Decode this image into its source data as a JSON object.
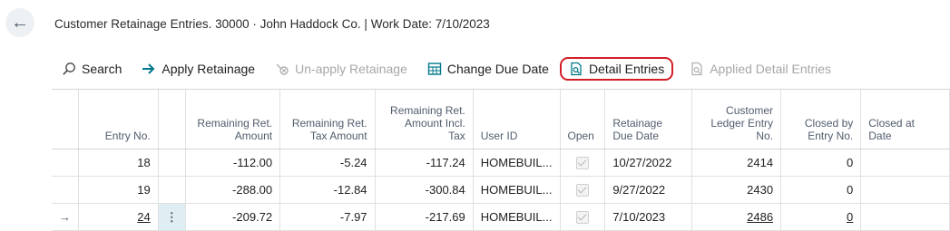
{
  "page": {
    "title": "Customer Retainage Entries. 30000 · John Haddock Co. | Work Date: 7/10/2023"
  },
  "toolbar": {
    "search": "Search",
    "apply_retainage": "Apply Retainage",
    "unapply_retainage": "Un-apply Retainage",
    "change_due_date": "Change Due Date",
    "detail_entries": "Detail Entries",
    "applied_detail_entries": "Applied Detail Entries"
  },
  "columns": {
    "entry_no": "Entry No.",
    "rem_amount": [
      "Remaining Ret.",
      "Amount"
    ],
    "rem_tax": [
      "Remaining Ret.",
      "Tax Amount"
    ],
    "rem_incl": [
      "Remaining Ret.",
      "Amount Incl.",
      "Tax"
    ],
    "user_id": "User ID",
    "open": "Open",
    "due_date": [
      "Retainage",
      "Due Date"
    ],
    "cle_no": [
      "Customer",
      "Ledger Entry",
      "No."
    ],
    "closed_by": [
      "Closed by",
      "Entry No."
    ],
    "closed_at": [
      "Closed at",
      "Date"
    ]
  },
  "rows": [
    {
      "entry_no": "18",
      "rem_amount": "-112.00",
      "rem_tax": "-5.24",
      "rem_incl": "-117.24",
      "user_id": "HOMEBUIL...",
      "open": true,
      "due_date": "10/27/2022",
      "cle_no": "2414",
      "closed_by": "0",
      "closed_at": "",
      "indicator": ""
    },
    {
      "entry_no": "19",
      "rem_amount": "-288.00",
      "rem_tax": "-12.84",
      "rem_incl": "-300.84",
      "user_id": "HOMEBUIL...",
      "open": true,
      "due_date": "9/27/2022",
      "cle_no": "2430",
      "closed_by": "0",
      "closed_at": "",
      "indicator": ""
    },
    {
      "entry_no": "24",
      "rem_amount": "-209.72",
      "rem_tax": "-7.97",
      "rem_incl": "-217.69",
      "user_id": "HOMEBUIL...",
      "open": true,
      "due_date": "7/10/2023",
      "cle_no": "2486",
      "closed_by": "0",
      "closed_at": "",
      "indicator": "→",
      "menu": "⋮"
    }
  ],
  "icons": {
    "back": "arrow-left-icon",
    "search": "search-icon",
    "apply": "arrow-right-icon",
    "unapply": "unapply-icon",
    "change_due_date": "calendar-grid-icon",
    "detail_entries": "document-search-icon",
    "applied_detail_entries": "document-search-icon"
  },
  "colors": {
    "accent": "#00788b",
    "highlight_border": "#d21f27",
    "selected_row_menu": "#dfeef2"
  }
}
